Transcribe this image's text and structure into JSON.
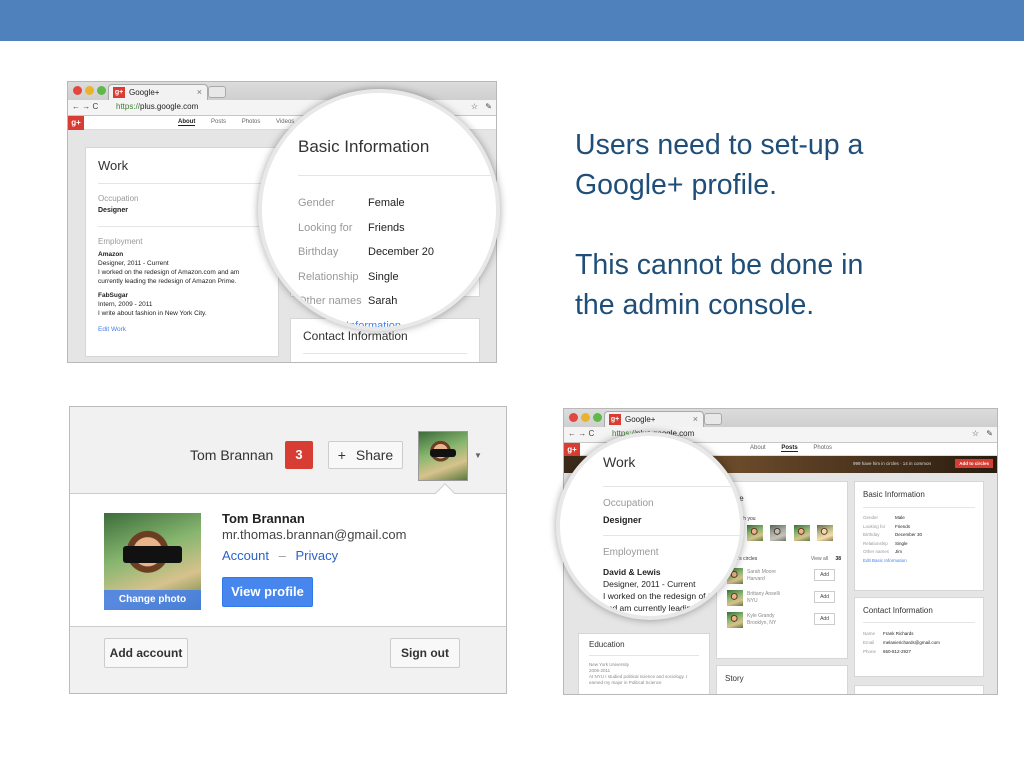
{
  "slide": {
    "text_line1": "Users need to set-up a",
    "text_line2": "Google+ profile.",
    "text_line3": "This cannot be done in",
    "text_line4": "the admin console.",
    "accent_color": "#4f81bd",
    "text_color": "#1f4e79"
  },
  "browser1": {
    "tab_title": "Google+",
    "tab_close": "×",
    "url_protocol": "https://",
    "url_host": "plus.google.com",
    "nav_tabs": [
      "About",
      "Posts",
      "Photos",
      "Videos"
    ],
    "work_card": {
      "title": "Work",
      "occupation_label": "Occupation",
      "occupation_value": "Designer",
      "employment_label": "Employment",
      "job1_company": "Amazon",
      "job1_role": "Designer, 2011 - Current",
      "job1_desc1": "I worked on the redesign of Amazon.com and am",
      "job1_desc2": "currently leading the redesign of Amazon Prime.",
      "job2_company": "FabSugar",
      "job2_role": "Intern, 2009 - 2011",
      "job2_desc": "I write about fashion in New York City.",
      "edit_link": "Edit Work"
    },
    "basic_info": {
      "title": "Basic Information",
      "rows": [
        {
          "label": "Gender",
          "value": "Female"
        },
        {
          "label": "Looking for",
          "value": "Friends"
        },
        {
          "label": "Birthday",
          "value": "December 20"
        },
        {
          "label": "Relationship",
          "value": "Single"
        },
        {
          "label": "Other names",
          "value": "Sarah"
        }
      ],
      "edit_link": "Information"
    },
    "contact_title": "Contact Information"
  },
  "account_menu": {
    "user_name": "Tom Brannan",
    "notification_count": "3",
    "share_label": "Share",
    "share_plus": "+",
    "display_name": "Tom Brannan",
    "email": "mr.thomas.brannan@gmail.com",
    "account_link": "Account",
    "separator": "–",
    "privacy_link": "Privacy",
    "change_photo": "Change photo",
    "view_profile": "View profile",
    "add_account": "Add account",
    "sign_out": "Sign out"
  },
  "browser2": {
    "tab_title": "Google+",
    "tab_close": "×",
    "url_protocol": "https://",
    "url_host": "plus.google.com",
    "nav_tabs": [
      "About",
      "Posts",
      "Photos"
    ],
    "banner_text": "999 have him in circles · 14 in common",
    "add_to_circles": "Add to circles",
    "work_zoom": {
      "title": "Work",
      "occupation_label": "Occupation",
      "occupation_value": "Designer",
      "employment_label": "Employment",
      "job_company": "David & Lewis",
      "job_role": "Designer, 2011 - Current",
      "job_desc1": "I worked on the redesign of the",
      "job_desc2": "and am currently leading th"
    },
    "people_card": {
      "title": "gle",
      "in_circles": "n with you",
      "their_circles": "sh's circles",
      "view_all": "View all",
      "count": "38",
      "add": "Add",
      "people": [
        {
          "name": "Sarah Moore",
          "place": "Harvard"
        },
        {
          "name": "Brittany Anselli",
          "place": "NYU"
        },
        {
          "name": "Kyle Grandy",
          "place": "Brooklyn, NY"
        }
      ]
    },
    "basic_info": {
      "title": "Basic Information",
      "rows": [
        {
          "label": "Gender",
          "value": "Male"
        },
        {
          "label": "Looking for",
          "value": "Friends"
        },
        {
          "label": "Birthday",
          "value": "December 30"
        },
        {
          "label": "Relationship",
          "value": "Single"
        },
        {
          "label": "Other names",
          "value": "Jim"
        }
      ],
      "edit_link": "Edit Basic Information"
    },
    "contact": {
      "title": "Contact Information",
      "rows": [
        {
          "label": "Name",
          "value": "Frank Richards"
        },
        {
          "label": "Email",
          "value": "melanierichards@gmail.com"
        },
        {
          "label": "Phone",
          "value": "650-812-2927"
        }
      ]
    },
    "education": {
      "title": "Education",
      "school": "New York University",
      "years": "2005-2011",
      "desc1": "At NYU I studied political science and sociology. I",
      "desc2": "earned my major in Political Science"
    },
    "story_title": "Story"
  }
}
